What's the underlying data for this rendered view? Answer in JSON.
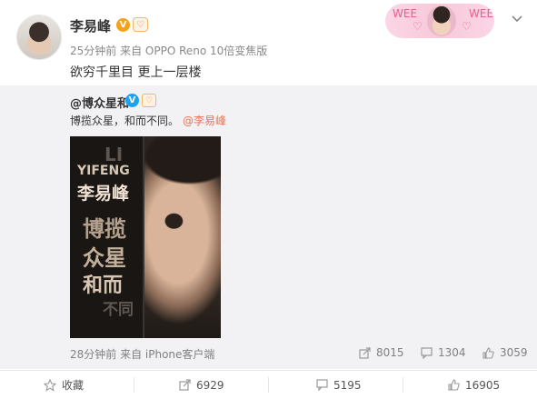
{
  "post": {
    "author": "李易峰",
    "badge_v": "V",
    "badge_fan": "♡",
    "meta": "25分钟前 来自 OPPO Reno 10倍变焦版",
    "content": "欲穷千里目 更上一层楼",
    "banner_emojis": [
      "WEE",
      "♡",
      "♡",
      "WEE"
    ]
  },
  "repost": {
    "author": "@博众星和",
    "badge_v": "V",
    "badge_fan": "♡",
    "text": "博揽众星，和而不同。",
    "mention": "@李易峰",
    "poster": {
      "li": "LI",
      "yifeng": "YIFENG",
      "name": "李易峰",
      "line1": "博揽",
      "line2": "众星",
      "line3": "和而",
      "line4": "不同"
    },
    "meta": "28分钟前 来自 iPhone客户端",
    "reposts": "8015",
    "comments": "1304",
    "likes": "3059"
  },
  "bar": {
    "favorite": "收藏",
    "reposts": "6929",
    "comments": "5195",
    "likes": "16905"
  },
  "colors": {
    "accent": "#eb7350",
    "repost_bg": "#f2f2f5",
    "v_orange": "#f5a21b",
    "v_blue": "#1da1f2"
  }
}
